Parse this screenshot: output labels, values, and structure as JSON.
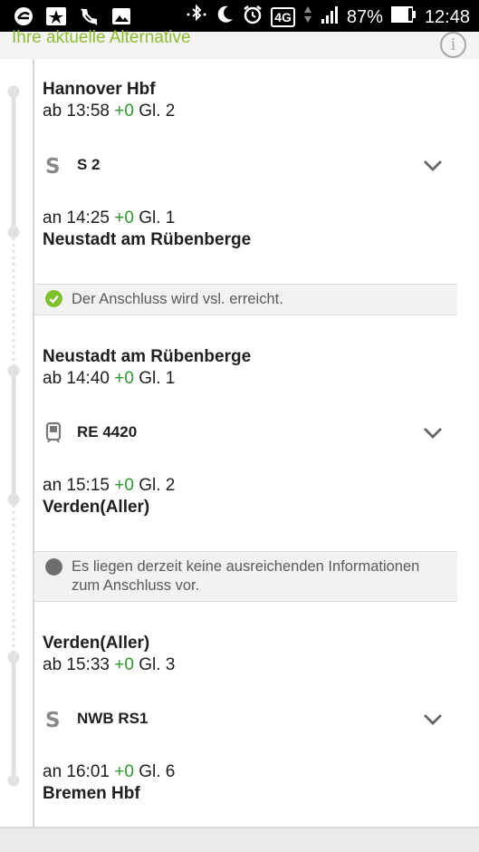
{
  "status_bar": {
    "battery": "87%",
    "time": "12:48",
    "network": "4G"
  },
  "header": {
    "title": "Ihre aktuelle Alternative"
  },
  "legs": [
    {
      "from_station": "Hannover Hbf",
      "dep_prefix": "ab 13:58",
      "dep_delay": "+0",
      "dep_platform": "Gl. 2",
      "train_icon": "sbahn-icon",
      "train": "S 2",
      "arr_prefix": "an 14:25",
      "arr_delay": "+0",
      "arr_platform": "Gl. 1",
      "to_station": "Neustadt am Rübenberge"
    },
    {
      "from_station": "Neustadt am Rübenberge",
      "dep_prefix": "ab 14:40",
      "dep_delay": "+0",
      "dep_platform": "Gl. 1",
      "train_icon": "regional-train-icon",
      "train": "RE 4420",
      "arr_prefix": "an 15:15",
      "arr_delay": "+0",
      "arr_platform": "Gl. 2",
      "to_station": "Verden(Aller)"
    },
    {
      "from_station": "Verden(Aller)",
      "dep_prefix": "ab 15:33",
      "dep_delay": "+0",
      "dep_platform": "Gl. 3",
      "train_icon": "sbahn-icon",
      "train": "NWB RS1",
      "arr_prefix": "an 16:01",
      "arr_delay": "+0",
      "arr_platform": "Gl. 6",
      "to_station": "Bremen Hbf"
    }
  ],
  "connections": [
    {
      "status": "ok",
      "color": "#7cc02a",
      "text": "Der Anschluss wird vsl. erreicht."
    },
    {
      "status": "unknown",
      "color": "#6e6e6e",
      "line1": "Es liegen derzeit keine ausreichenden Informationen",
      "line2": "zum Anschluss vor."
    }
  ]
}
